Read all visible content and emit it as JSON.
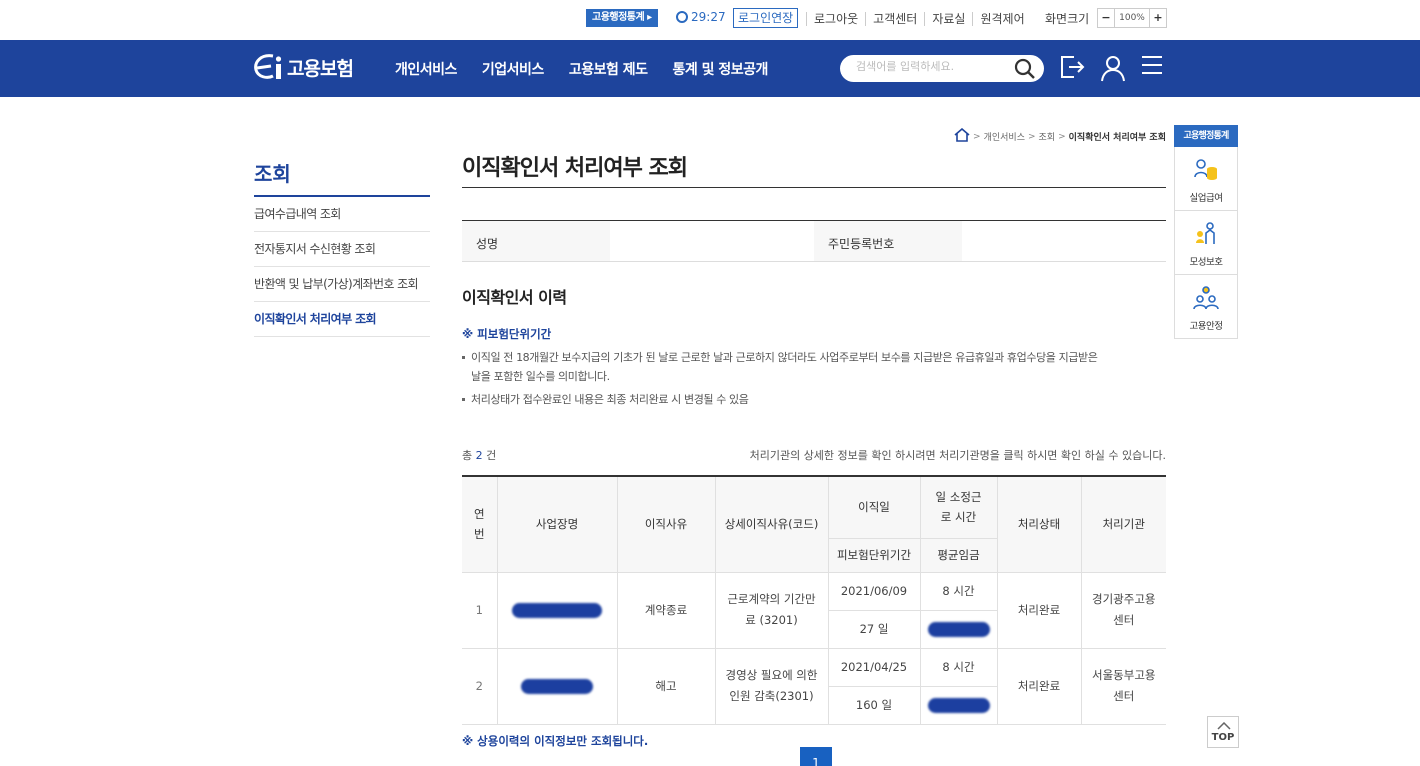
{
  "util": {
    "stats_button": "고용행정통계 ▸",
    "timer": "29:27",
    "extend_login": "로그인연장",
    "links": [
      "로그아웃",
      "고객센터",
      "자료실",
      "원격제어",
      "화면크기"
    ],
    "zoom_minus": "−",
    "zoom_value": "100%",
    "zoom_plus": "+"
  },
  "header": {
    "logo_text": "고용보험",
    "menu": [
      "개인서비스",
      "기업서비스",
      "고용보험 제도",
      "통계 및 정보공개"
    ],
    "search_placeholder": "검색어를 입력하세요."
  },
  "breadcrumb": [
    "개인서비스",
    "조회",
    "이직확인서 처리여부 조회"
  ],
  "lnb": {
    "title": "조회",
    "items": [
      "급여수급내역 조회",
      "전자통지서 수신현황 조회",
      "반환액 및 납부(가상)계좌번호 조회",
      "이직확인서 처리여부 조회"
    ]
  },
  "main": {
    "page_title": "이직확인서 처리여부 조회",
    "info": {
      "name_label": "성명",
      "rrn_label": "주민등록번호"
    },
    "section_title": "이직확인서 이력",
    "note_head": "※ 피보험단위기간",
    "bullets": [
      "이직일 전 18개월간 보수지급의 기초가 된 날로 근로한 날과 근로하지 않더라도 사업주로부터 보수를 지급받은 유급휴일과 휴업수당을 지급받은",
      "날을 포함한 일수를 의미합니다.",
      "처리상태가 접수완료인 내용은 최종 처리완료 시 변경될 수 있음"
    ],
    "count_prefix": "총",
    "count": "2",
    "count_suffix": "건",
    "meta_hint": "처리기관의 상세한 정보를 확인 하시려면 처리기관명을 클릭 하시면 확인 하실 수 있습니다.",
    "table": {
      "headers": {
        "no": "연번",
        "workplace": "사업장명",
        "reason": "이직사유",
        "detail": "상세이직사유(코드)",
        "date": "이직일",
        "hours": "일 소정근로 시간",
        "status": "처리상태",
        "agency": "처리기관",
        "period": "피보험단위기간",
        "wage": "평균임금"
      },
      "rows": [
        {
          "no": "1",
          "reason": "계약종료",
          "detail": "근로계약의 기간만료 (3201)",
          "date": "2021/06/09",
          "hours": "8 시간",
          "period": "27 일",
          "status": "처리완료",
          "agency": "경기광주고용 센터"
        },
        {
          "no": "2",
          "reason": "해고",
          "detail": "경영상 필요에 의한 인원 감축(2301)",
          "date": "2021/04/25",
          "hours": "8 시간",
          "period": "160 일",
          "status": "처리완료",
          "agency": "서울동부고용 센터"
        }
      ]
    },
    "footnote": "※ 상용이력의 이직정보만 조회됩니다.",
    "page": "1"
  },
  "quick": {
    "title": "고용행정통계",
    "items": [
      "실업급여",
      "모성보호",
      "고용안정"
    ]
  },
  "top_label": "TOP"
}
